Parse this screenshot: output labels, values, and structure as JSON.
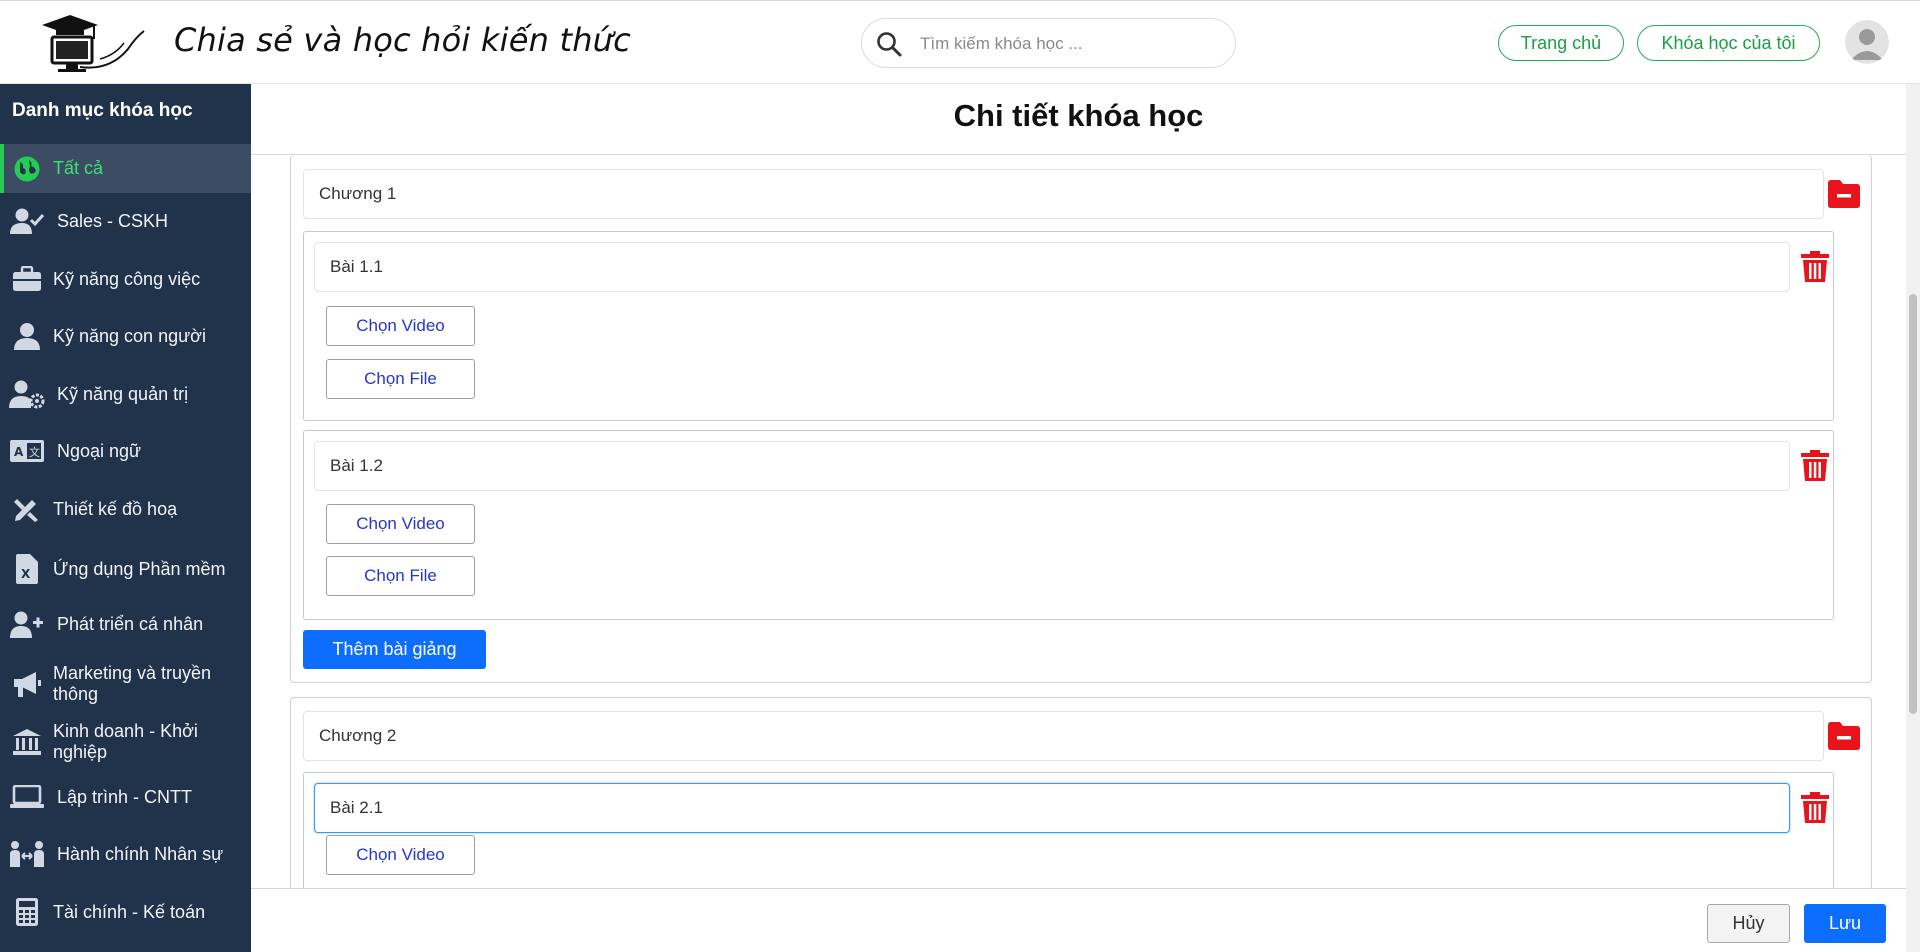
{
  "header": {
    "site_title": "Chia sẻ và học hỏi kiến thức",
    "search_placeholder": "Tìm kiếm khóa học ...",
    "nav_home": "Trang chủ",
    "nav_my_courses": "Khóa học của tôi"
  },
  "sidebar": {
    "title": "Danh mục khóa học",
    "items": [
      {
        "label": "Tất cả",
        "icon": "globe-icon",
        "active": true
      },
      {
        "label": "Sales - CSKH",
        "icon": "user-check-icon"
      },
      {
        "label": "Kỹ năng công việc",
        "icon": "briefcase-icon"
      },
      {
        "label": "Kỹ năng con người",
        "icon": "user-icon"
      },
      {
        "label": "Kỹ năng quản trị",
        "icon": "user-gear-icon"
      },
      {
        "label": "Ngoại ngữ",
        "icon": "language-icon"
      },
      {
        "label": "Thiết kế đồ hoạ",
        "icon": "design-tools-icon"
      },
      {
        "label": "Ứng dụng Phần mềm",
        "icon": "excel-file-icon"
      },
      {
        "label": "Phát triển cá nhân",
        "icon": "user-plus-icon"
      },
      {
        "label": "Marketing và truyền thông",
        "icon": "megaphone-icon"
      },
      {
        "label": "Kinh doanh - Khởi nghiệp",
        "icon": "bank-icon"
      },
      {
        "label": "Lập trình - CNTT",
        "icon": "laptop-icon"
      },
      {
        "label": "Hành chính Nhân sự",
        "icon": "people-arrows-icon"
      },
      {
        "label": "Tài chính - Kế toán",
        "icon": "calculator-icon"
      }
    ]
  },
  "main": {
    "page_title": "Chi tiết khóa học",
    "choose_video": "Chọn Video",
    "choose_file": "Chọn File",
    "add_lesson": "Thêm bài giảng",
    "chapters": [
      {
        "name": "Chương 1",
        "lessons": [
          "Bài 1.1",
          "Bài 1.2"
        ]
      },
      {
        "name": "Chương 2",
        "lessons": [
          "Bài 2.1"
        ]
      }
    ]
  },
  "footer": {
    "cancel": "Hủy",
    "save": "Lưu"
  },
  "colors": {
    "sidebar_bg": "#21334a",
    "active_green": "#22cc55",
    "primary_blue": "#0d6efd",
    "delete_red": "#e8141c"
  }
}
